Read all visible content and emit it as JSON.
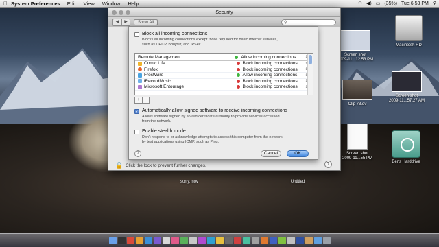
{
  "menubar": {
    "apple": "",
    "app_name": "System Preferences",
    "items": [
      "Edit",
      "View",
      "Window",
      "Help"
    ],
    "battery": "(35%)",
    "clock": "Tue 6:53 PM"
  },
  "window": {
    "title": "Security",
    "show_all": "Show All",
    "search_placeholder": "",
    "lock_text": "Click the lock to prevent further changes.",
    "help": "?"
  },
  "sheet": {
    "block_all": {
      "label": "Block all incoming connections",
      "checked": false,
      "desc1": "Blocks all incoming connections except those required for basic Internet services,",
      "desc2": "such as DHCP, Bonjour, and IPSec."
    },
    "apps": [
      {
        "name": "Remote Management",
        "status": "Allow incoming connections",
        "status_color": "#3fb53f",
        "icon_color": "",
        "header": true
      },
      {
        "name": "Comic Life",
        "status": "Block incoming connections",
        "status_color": "#d83a3a",
        "icon_color": "#f0b42a"
      },
      {
        "name": "Firefox",
        "status": "Block incoming connections",
        "status_color": "#d83a3a",
        "icon_color": "#e8622a"
      },
      {
        "name": "FrostWire",
        "status": "Allow incoming connections",
        "status_color": "#3fb53f",
        "icon_color": "#4aa3e0"
      },
      {
        "name": "iRecordMusic",
        "status": "Block incoming connections",
        "status_color": "#d83a3a",
        "icon_color": "#6fb1e8"
      },
      {
        "name": "Microsoft Entourage",
        "status": "Block incoming connections",
        "status_color": "#d83a3a",
        "icon_color": "#b07ad0"
      }
    ],
    "plus": "+",
    "minus": "−",
    "auto_allow": {
      "label": "Automatically allow signed software to receive incoming connections",
      "checked": true,
      "desc1": "Allows software signed by a valid certificate authority to provide services accessed",
      "desc2": "from the network."
    },
    "stealth": {
      "label": "Enable stealth mode",
      "checked": false,
      "desc1": "Don't respond to or acknowledge attempts to access this computer from the network",
      "desc2": "by test applications using ICMP, such as Ping."
    },
    "help": "?",
    "cancel": "Cancel",
    "ok": "OK"
  },
  "desktop": {
    "icons": [
      {
        "name": "Macintosh HD"
      },
      {
        "line1": "Screen shot",
        "line2": "2009-11...12.53 PM"
      },
      {
        "line1": "Screen shot",
        "line2": "2009-11...57.27 AM"
      },
      {
        "line1": "Clip 73.dv"
      },
      {
        "line1": "Screen shot",
        "line2": "2009-11...55 PM"
      },
      {
        "name": "Bens Harddrive"
      },
      {
        "line1": "sorry.mov"
      },
      {
        "line1": "Untitled"
      }
    ]
  },
  "colors": {
    "allow": "#3fb53f",
    "block": "#d83a3a",
    "accent": "#3f86df"
  }
}
